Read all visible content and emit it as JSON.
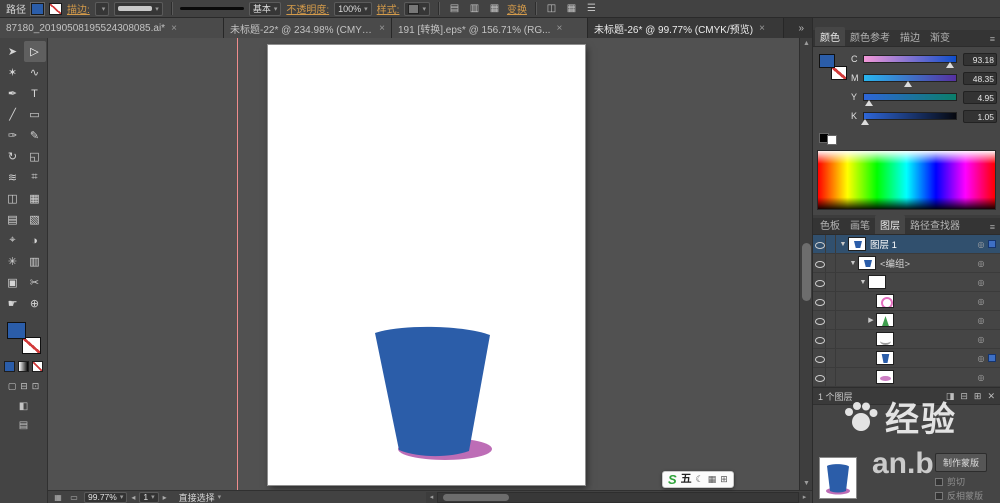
{
  "control_bar": {
    "context_label": "路径",
    "stroke_label": "描边:",
    "brush_def": "基本",
    "opacity_label": "不透明度:",
    "opacity_value": "100%",
    "style_label": "样式:",
    "transform_label": "变换"
  },
  "tab_bar": {
    "overflow_glyph": "»",
    "tabs": [
      {
        "label": "87180_20190508195524308085.ai*"
      },
      {
        "label": "未标题-22* @ 234.98% (CMYK/..."
      },
      {
        "label": "191 [转换].eps* @ 156.71% (RG..."
      },
      {
        "label": "未标题-26* @ 99.77% (CMYK/预览)"
      }
    ]
  },
  "toolbar": {
    "tools": [
      {
        "name": "selection",
        "glyph": "➤"
      },
      {
        "name": "direct-selection",
        "glyph": "▷"
      },
      {
        "name": "magic-wand",
        "glyph": "✶"
      },
      {
        "name": "lasso",
        "glyph": "∿"
      },
      {
        "name": "pen",
        "glyph": "✒"
      },
      {
        "name": "type",
        "glyph": "T"
      },
      {
        "name": "line",
        "glyph": "╱"
      },
      {
        "name": "rectangle",
        "glyph": "▭"
      },
      {
        "name": "paintbrush",
        "glyph": "✑"
      },
      {
        "name": "pencil",
        "glyph": "✎"
      },
      {
        "name": "rotate",
        "glyph": "↻"
      },
      {
        "name": "scale",
        "glyph": "◱"
      },
      {
        "name": "width",
        "glyph": "≋"
      },
      {
        "name": "free-transform",
        "glyph": "⌗"
      },
      {
        "name": "shape-builder",
        "glyph": "◫"
      },
      {
        "name": "perspective-grid",
        "glyph": "▦"
      },
      {
        "name": "mesh",
        "glyph": "▤"
      },
      {
        "name": "gradient",
        "glyph": "▧"
      },
      {
        "name": "eyedropper",
        "glyph": "⌖"
      },
      {
        "name": "blend",
        "glyph": "◑"
      },
      {
        "name": "symbol-sprayer",
        "glyph": "✳"
      },
      {
        "name": "graph",
        "glyph": "▥"
      },
      {
        "name": "artboard",
        "glyph": "▣"
      },
      {
        "name": "slice",
        "glyph": "✂"
      },
      {
        "name": "hand",
        "glyph": "☛"
      },
      {
        "name": "zoom",
        "glyph": "⊕"
      }
    ]
  },
  "color_panel": {
    "tabs": [
      {
        "label": "颜色"
      },
      {
        "label": "颜色参考"
      },
      {
        "label": "描边"
      },
      {
        "label": "渐变"
      }
    ],
    "sliders": [
      {
        "ch": "C",
        "value": "93.18"
      },
      {
        "ch": "M",
        "value": "48.35"
      },
      {
        "ch": "Y",
        "value": "4.95"
      },
      {
        "ch": "K",
        "value": "1.05"
      }
    ]
  },
  "panel_tabs": [
    {
      "label": "色板"
    },
    {
      "label": "画笔"
    },
    {
      "label": "图层"
    },
    {
      "label": "路径查找器"
    }
  ],
  "layers": {
    "rows": [
      {
        "name": "图层 1",
        "twirl": "▼",
        "thumb": "art",
        "selected": "true"
      },
      {
        "name": "<编组>",
        "twirl": "▼",
        "thumb": "art"
      },
      {
        "name": "",
        "twirl": "▼",
        "thumb": "blank"
      },
      {
        "name": "",
        "twirl": "",
        "thumb": "pink-outline"
      },
      {
        "name": "",
        "twirl": "▶",
        "thumb": "green-plant"
      },
      {
        "name": "",
        "twirl": "",
        "thumb": "sketch"
      },
      {
        "name": "",
        "twirl": "",
        "thumb": "blue-cup",
        "art_selected": "true"
      },
      {
        "name": "",
        "twirl": "",
        "thumb": "pink-ellipse"
      }
    ],
    "status": "1 个图层"
  },
  "transparency": {
    "make_mask": "制作蒙版",
    "clip": "剪切",
    "invert": "反相蒙版"
  },
  "status_bar": {
    "zoom": "99.77%",
    "artboard": "1",
    "tool": "直接选择"
  },
  "watermark": {
    "brand": "经验",
    "partial": "an.b"
  },
  "ime": {
    "mode": "五"
  },
  "artwork": {
    "cup_color": "#2b5da9",
    "saucer_color": "#bd6db6"
  }
}
